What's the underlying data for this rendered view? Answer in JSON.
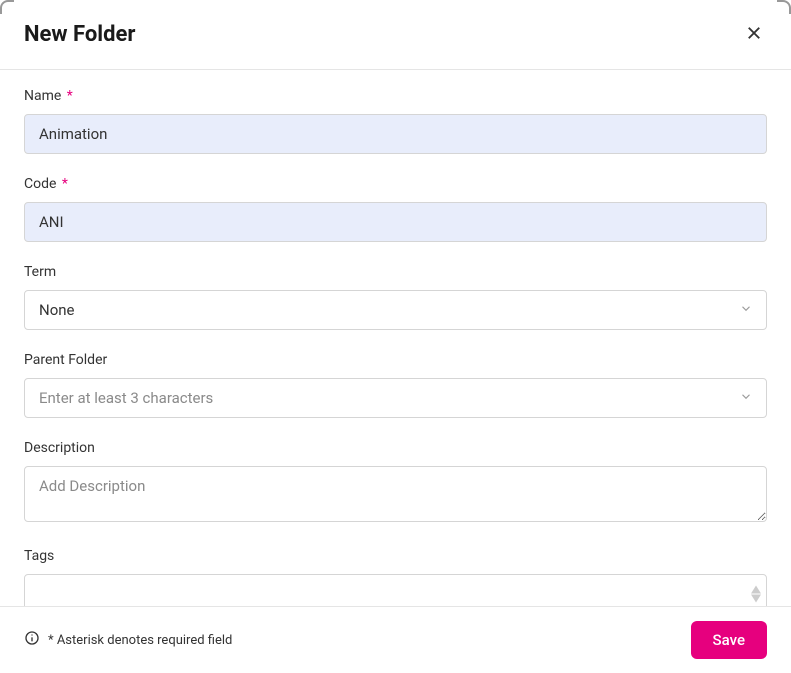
{
  "header": {
    "title": "New Folder"
  },
  "fields": {
    "name": {
      "label": "Name",
      "required_mark": "*",
      "value": "Animation"
    },
    "code": {
      "label": "Code",
      "required_mark": "*",
      "value": "ANI"
    },
    "term": {
      "label": "Term",
      "value": "None"
    },
    "parent_folder": {
      "label": "Parent Folder",
      "placeholder": "Enter at least 3 characters"
    },
    "description": {
      "label": "Description",
      "placeholder": "Add Description"
    },
    "tags": {
      "label": "Tags"
    }
  },
  "footer": {
    "note": "* Asterisk denotes required field",
    "save_label": "Save"
  }
}
